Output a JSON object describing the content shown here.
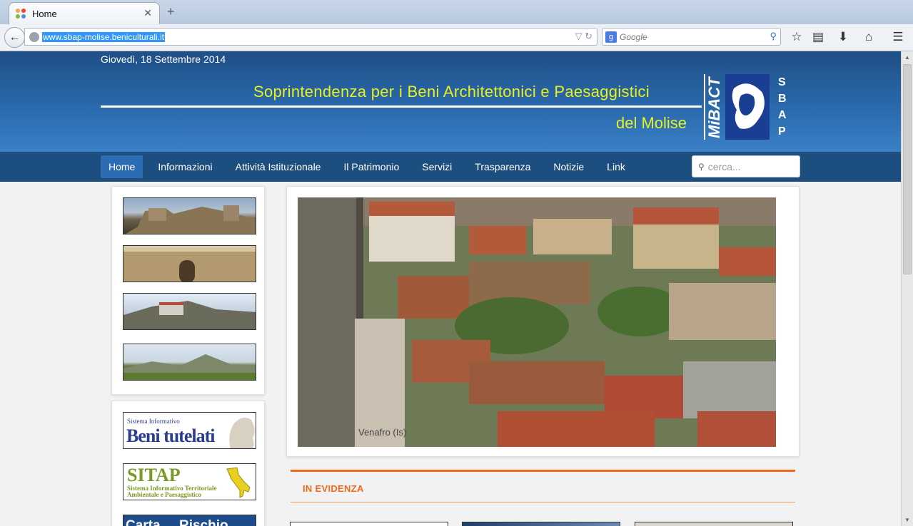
{
  "browser": {
    "tab_title": "Home",
    "url": "www.sbap-molise.beniculturali.it",
    "search_placeholder": "Google"
  },
  "header": {
    "date": "Giovedì, 18 Settembre 2014",
    "title_line1": "Soprintendenza per i Beni Architettonici e Paesaggistici",
    "title_line2": "del Molise",
    "logo_left": "MiBACT",
    "logo_right": "SBAP"
  },
  "menu": {
    "items": [
      "Home",
      "Informazioni",
      "Attività Istituzionale",
      "Il Patrimonio",
      "Servizi",
      "Trasparenza",
      "Notizie",
      "Link"
    ],
    "search_placeholder": "cerca..."
  },
  "sidebar": {
    "banner1_small": "Sistema Informativo",
    "banner1_big": "Beni tutelati",
    "banner2_big": "SITAP",
    "banner2_small1": "Sistema Informativo Territoriale",
    "banner2_small2": "Ambientale e Paesaggistico",
    "banner3_big": "Carta     Rischio"
  },
  "main": {
    "caption": "Venafro (Is)",
    "evidenza_label": "IN EVIDENZA"
  },
  "colors": {
    "header_blue": "#2b6bb0",
    "menu_blue": "#1d4e80",
    "title_yellow": "#e8f020",
    "accent_orange": "#ef6a1a"
  }
}
